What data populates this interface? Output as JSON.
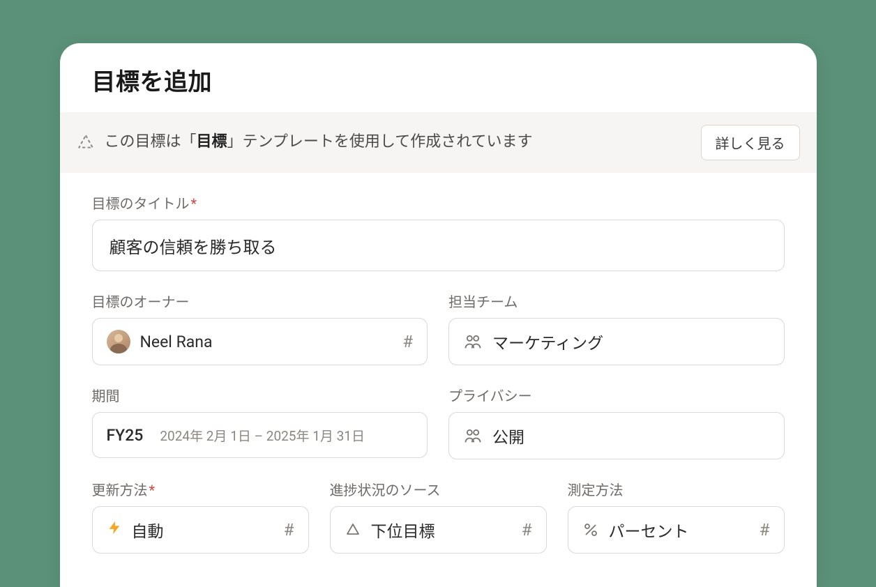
{
  "modal": {
    "title": "目標を追加"
  },
  "banner": {
    "prefix": "この目標は「",
    "template_name": "目標",
    "suffix": "」テンプレートを使用して作成されています",
    "learn_more": "詳しく見る"
  },
  "fields": {
    "title": {
      "label": "目標のタイトル",
      "required_mark": "*",
      "value": "顧客の信頼を勝ち取る"
    },
    "owner": {
      "label": "目標のオーナー",
      "value": "Neel Rana"
    },
    "team": {
      "label": "担当チーム",
      "value": "マーケティング"
    },
    "period": {
      "label": "期間",
      "value": "FY25",
      "range": "2024年 2月 1日 – 2025年 1月 31日"
    },
    "privacy": {
      "label": "プライバシー",
      "value": "公開"
    },
    "update_method": {
      "label": "更新方法",
      "required_mark": "*",
      "value": "自動"
    },
    "progress_source": {
      "label": "進捗状況のソース",
      "value": "下位目標"
    },
    "measurement": {
      "label": "測定方法",
      "value": "パーセント"
    }
  },
  "icons": {
    "hash": "#"
  }
}
